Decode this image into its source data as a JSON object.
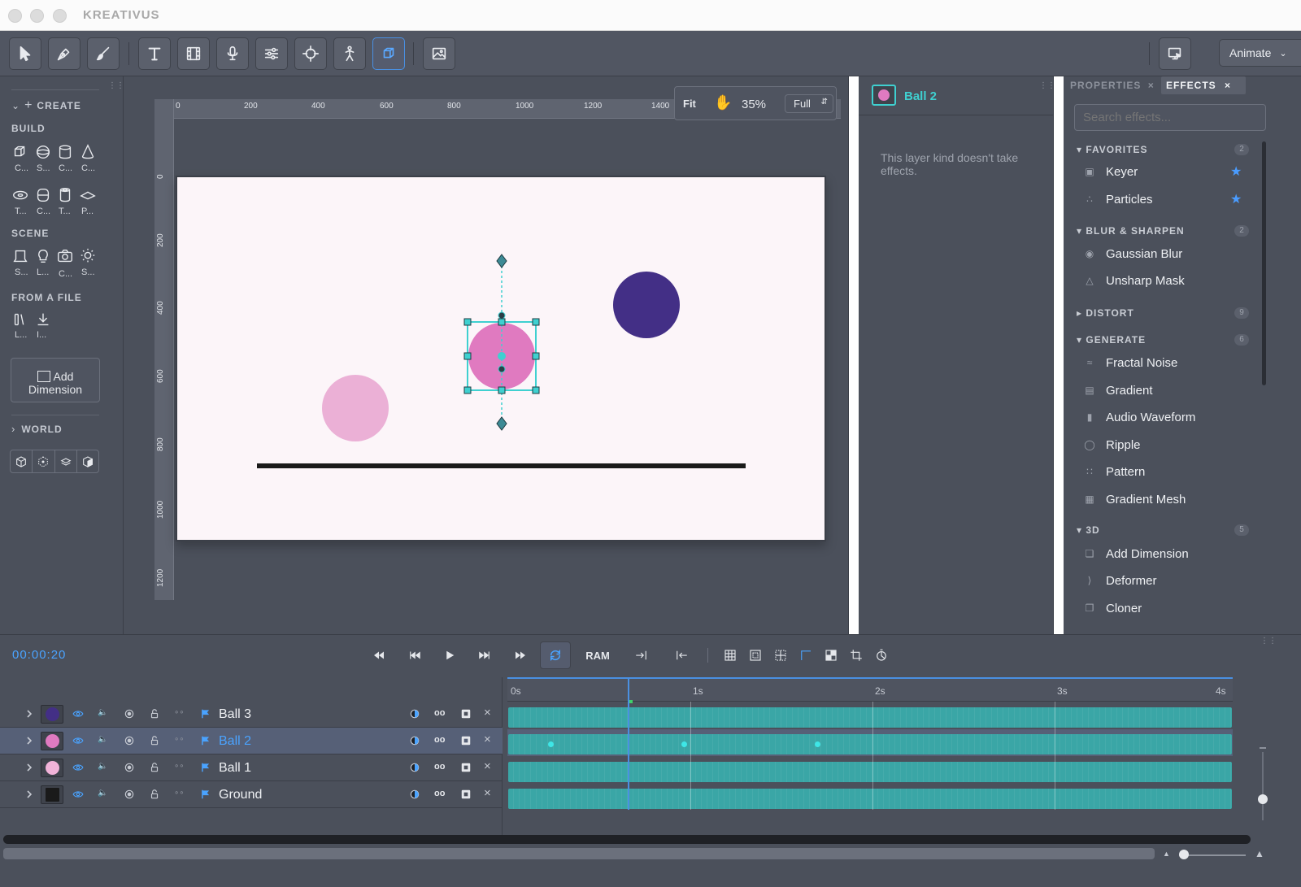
{
  "app": {
    "title": "KREATIVUS"
  },
  "toolbar": {
    "tools": [
      "select-tool",
      "pen-tool",
      "brush-tool",
      "text-tool",
      "film-tool",
      "microphone-tool",
      "adjust-tool",
      "target-tool",
      "puppet-tool",
      "3d-tool",
      "image-tool"
    ],
    "active_tool": "3d-tool",
    "animate_label": "Animate"
  },
  "left_panel": {
    "create_label": "CREATE",
    "build_label": "BUILD",
    "build_items": [
      "C...",
      "S...",
      "C...",
      "C...",
      "T...",
      "C...",
      "T...",
      "P..."
    ],
    "scene_label": "SCENE",
    "scene_items": [
      "S...",
      "L...",
      "C...",
      "S..."
    ],
    "file_label": "FROM A FILE",
    "file_items": [
      "L...",
      "I..."
    ],
    "add_dimension_line1": "Add",
    "add_dimension_line2": "Dimension",
    "world_label": "WORLD"
  },
  "canvas": {
    "zoom_fit": "Fit",
    "zoom_value": "35%",
    "quality": "Full",
    "ruler_top": [
      "0",
      "200",
      "400",
      "600",
      "800",
      "1000",
      "1200",
      "1400"
    ],
    "ruler_left": [
      "0",
      "200",
      "400",
      "600",
      "800",
      "1000",
      "1200"
    ],
    "colors": {
      "ball3": "#432f86",
      "ball2": "#e07ac0",
      "ball1": "#ebb0d6",
      "ground": "#1a1a1a",
      "selection": "#3fd0d0"
    }
  },
  "layer_panel": {
    "layer_name": "Ball 2",
    "message": "This layer kind doesn't take effects."
  },
  "effects_panel": {
    "tab_properties": "PROPERTIES",
    "tab_effects": "EFFECTS",
    "search_placeholder": "Search effects...",
    "categories": [
      {
        "name": "FAVORITES",
        "count": "2",
        "expanded": true,
        "items": [
          {
            "label": "Keyer",
            "starred": true
          },
          {
            "label": "Particles",
            "starred": true
          }
        ]
      },
      {
        "name": "BLUR & SHARPEN",
        "count": "2",
        "expanded": true,
        "items": [
          {
            "label": "Gaussian Blur"
          },
          {
            "label": "Unsharp Mask"
          }
        ]
      },
      {
        "name": "DISTORT",
        "count": "9",
        "expanded": false,
        "items": []
      },
      {
        "name": "GENERATE",
        "count": "6",
        "expanded": true,
        "items": [
          {
            "label": "Fractal Noise"
          },
          {
            "label": "Gradient"
          },
          {
            "label": "Audio Waveform"
          },
          {
            "label": "Ripple"
          },
          {
            "label": "Pattern"
          },
          {
            "label": "Gradient Mesh"
          }
        ]
      },
      {
        "name": "3D",
        "count": "5",
        "expanded": true,
        "items": [
          {
            "label": "Add Dimension"
          },
          {
            "label": "Deformer"
          },
          {
            "label": "Cloner"
          }
        ]
      }
    ]
  },
  "timeline": {
    "current_time": "00:00:20",
    "ram_label": "RAM",
    "seconds": [
      "0s",
      "1s",
      "2s",
      "3s",
      "4s"
    ],
    "layers": [
      {
        "name": "Ball 3",
        "color": "#432f86",
        "selected": false
      },
      {
        "name": "Ball 2",
        "color": "#e07ac0",
        "selected": true
      },
      {
        "name": "Ball 1",
        "color": "#f1b3d9",
        "selected": false
      },
      {
        "name": "Ground",
        "color": "#1a1a1a",
        "selected": false
      }
    ]
  }
}
